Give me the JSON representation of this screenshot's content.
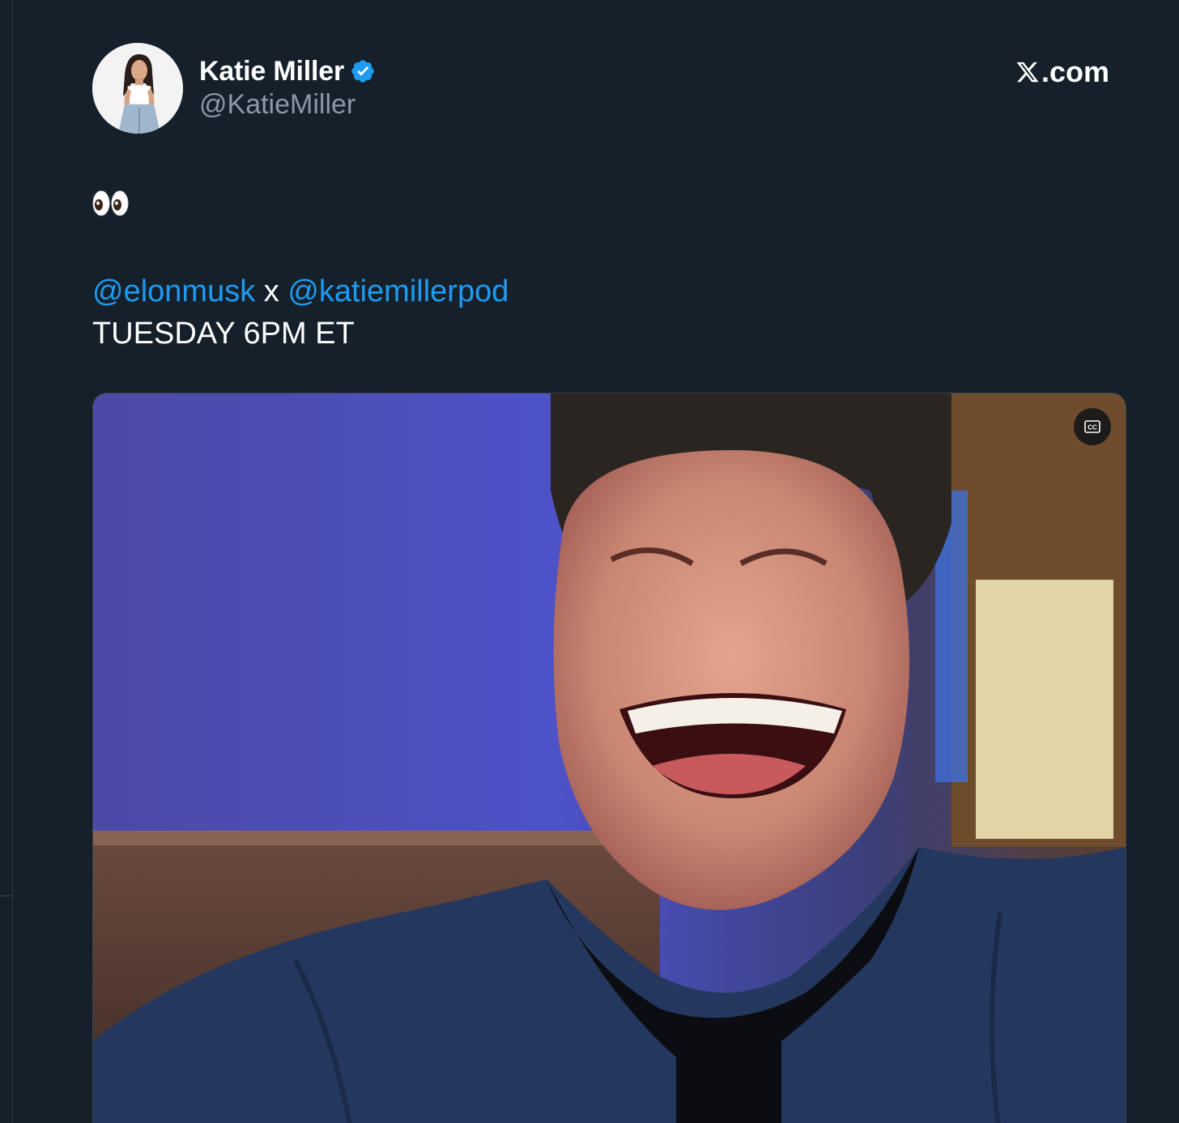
{
  "tweet": {
    "author": {
      "display_name": "Katie Miller",
      "handle": "@KatieMiller",
      "verified": true
    },
    "site": {
      "domain_suffix": ".com",
      "logo_icon": "x-logo-icon"
    },
    "emoji": "👀",
    "body": {
      "mention_1": "@elonmusk",
      "joiner": " x ",
      "mention_2": "@katiemillerpod",
      "line_2": "TUESDAY 6PM ET"
    },
    "media": {
      "cc_icon": "closed-captions-icon"
    }
  },
  "colors": {
    "background": "#15202b",
    "link": "#1d9bf0",
    "text": "#ffffff",
    "muted": "#8b98a5",
    "verified_badge": "#1d9bf0"
  }
}
